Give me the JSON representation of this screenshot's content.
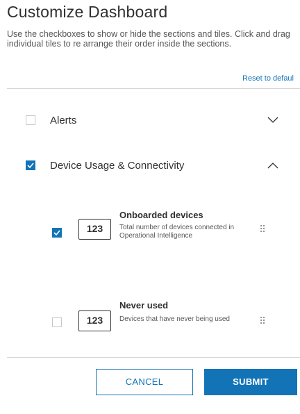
{
  "header": {
    "title": "Customize Dashboard",
    "description": "Use the checkboxes to show or hide the sections and tiles. Click and drag individual tiles to re arrange their order inside the sections.",
    "reset_label": "Reset to defaul"
  },
  "sections": [
    {
      "label": "Alerts",
      "checked": false,
      "expanded": false,
      "chevron_icon": "chevron-down-icon"
    },
    {
      "label": "Device Usage & Connectivity",
      "checked": true,
      "expanded": true,
      "chevron_icon": "chevron-up-icon"
    }
  ],
  "tiles": [
    {
      "badge": "123",
      "title": "Onboarded devices",
      "description": "Total number of devices connected in Operational Intelligence",
      "checked": true,
      "drag_icon": "drag-handle-icon"
    },
    {
      "badge": "123",
      "title": "Never used",
      "description": "Devices that have never being used",
      "checked": false,
      "drag_icon": "drag-handle-icon"
    }
  ],
  "footer": {
    "cancel_label": "CANCEL",
    "submit_label": "SUBMIT"
  },
  "colors": {
    "accent": "#1274b7",
    "text": "#303030",
    "divider": "#d6d6d6"
  }
}
